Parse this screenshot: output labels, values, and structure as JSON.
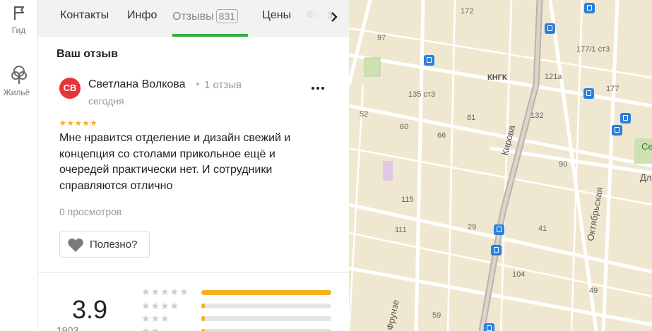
{
  "rail": {
    "items": [
      {
        "label": "Гид",
        "icon": "flag-icon"
      },
      {
        "label": "Жильё",
        "icon": "tree-icon"
      }
    ]
  },
  "tabs": [
    {
      "label": "Контакты"
    },
    {
      "label": "Инфо"
    },
    {
      "label": "Отзывы",
      "count": "831",
      "active": true
    },
    {
      "label": "Цены"
    },
    {
      "label": "Фото"
    }
  ],
  "review": {
    "heading": "Ваш отзыв",
    "avatar_initials": "СВ",
    "avatar_color": "#e8353a",
    "author": "Светлана Волкова",
    "separator": "•",
    "author_reviews": "1 отзыв",
    "date": "сегодня",
    "rating": 5,
    "stars": "★★★★★",
    "text": "Мне нравится отделение и дизайн свежий и концепция со столами прикольное ещё и очередей практически нет. И сотрудники справляются отлично",
    "views": "0 просмотров",
    "useful_label": "Полезно?"
  },
  "summary": {
    "rating": "3.9",
    "count_partial": "1903",
    "distribution": [
      {
        "stars": "★★★★★",
        "fraction": 1.0
      },
      {
        "stars": "★★★★",
        "fraction": 0.02
      },
      {
        "stars": "★★★",
        "fraction": 0.02
      },
      {
        "stars": "★★",
        "fraction": 0.02
      }
    ]
  },
  "map": {
    "colors": {
      "background": "#efe7cf",
      "road": "#ffffff",
      "major_road": "#b9b4a8",
      "bus_stop": "#2a7fe0"
    },
    "labels": [
      "172",
      "97",
      "177/1 ст3",
      "КНГК",
      "121а",
      "135 ст3",
      "177",
      "52",
      "60",
      "81",
      "132",
      "66",
      "90",
      "115",
      "111",
      "29",
      "41",
      "104",
      "49",
      "59"
    ],
    "streets": [
      "Кирова",
      "Октябрьская",
      "Фрунзе"
    ],
    "edge_labels": [
      "Се",
      "Дл"
    ]
  }
}
